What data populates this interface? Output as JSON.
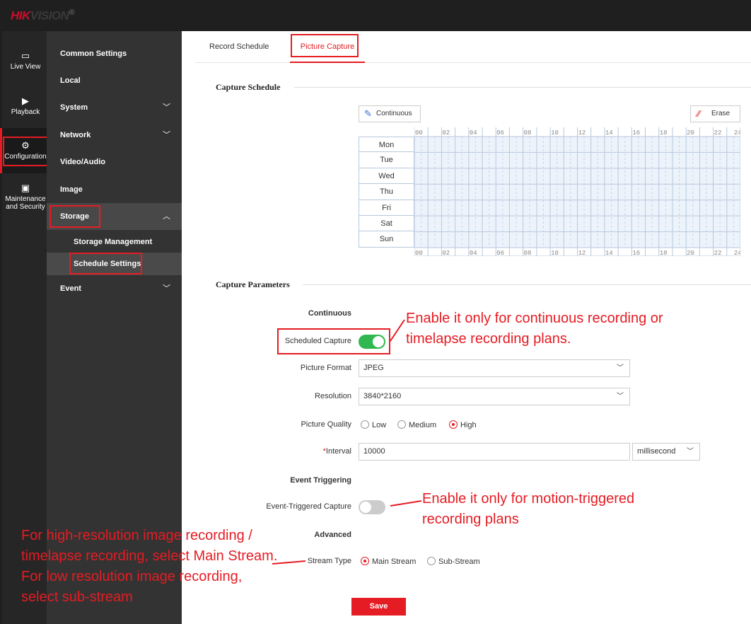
{
  "brand": {
    "name": "HIKVISION",
    "accent": "#e51c23"
  },
  "rail": [
    {
      "label": "Live View",
      "icon": "live-view-icon"
    },
    {
      "label": "Playback",
      "icon": "playback-icon"
    },
    {
      "label": "Configuration",
      "icon": "gear-icon"
    },
    {
      "label": "Maintenance and Security",
      "icon": "maintenance-icon"
    }
  ],
  "menu": {
    "common": "Common Settings",
    "local": "Local",
    "system": "System",
    "network": "Network",
    "video": "Video/Audio",
    "image": "Image",
    "storage": "Storage",
    "storage_mgmt": "Storage Management",
    "schedule": "Schedule Settings",
    "event": "Event"
  },
  "tabs": {
    "record": "Record Schedule",
    "capture": "Picture Capture"
  },
  "schedule": {
    "title": "Capture Schedule",
    "continuous": "Continuous",
    "erase": "Erase",
    "days": [
      "Mon",
      "Tue",
      "Wed",
      "Thu",
      "Fri",
      "Sat",
      "Sun"
    ],
    "hours": [
      "00",
      "02",
      "04",
      "06",
      "08",
      "10",
      "12",
      "14",
      "16",
      "18",
      "20",
      "22",
      "24"
    ]
  },
  "params": {
    "title": "Capture Parameters",
    "continuous": "Continuous",
    "scheduled_capture": "Scheduled Capture",
    "scheduled_on": true,
    "picture_format": "Picture Format",
    "format_value": "JPEG",
    "resolution": "Resolution",
    "resolution_value": "3840*2160",
    "quality": "Picture Quality",
    "quality_options": [
      "Low",
      "Medium",
      "High"
    ],
    "quality_selected": "High",
    "interval": "Interval",
    "required": "*",
    "interval_value": "10000",
    "interval_unit": "millisecond",
    "event_triggering": "Event Triggering",
    "event_capture": "Event-Triggered Capture",
    "event_on": false,
    "advanced": "Advanced",
    "stream_type": "Stream Type",
    "stream_options": [
      "Main Stream",
      "Sub-Stream"
    ],
    "stream_selected": "Main Stream",
    "save": "Save"
  },
  "notes": {
    "n1": "Enable it only for continuous recording or timelapse recording plans.",
    "n2": "Enable it only for motion-triggered recording plans",
    "n3": "For high-resolution image recording / timelapse recording, select Main Stream. For low resolution image recording, select sub-stream"
  }
}
